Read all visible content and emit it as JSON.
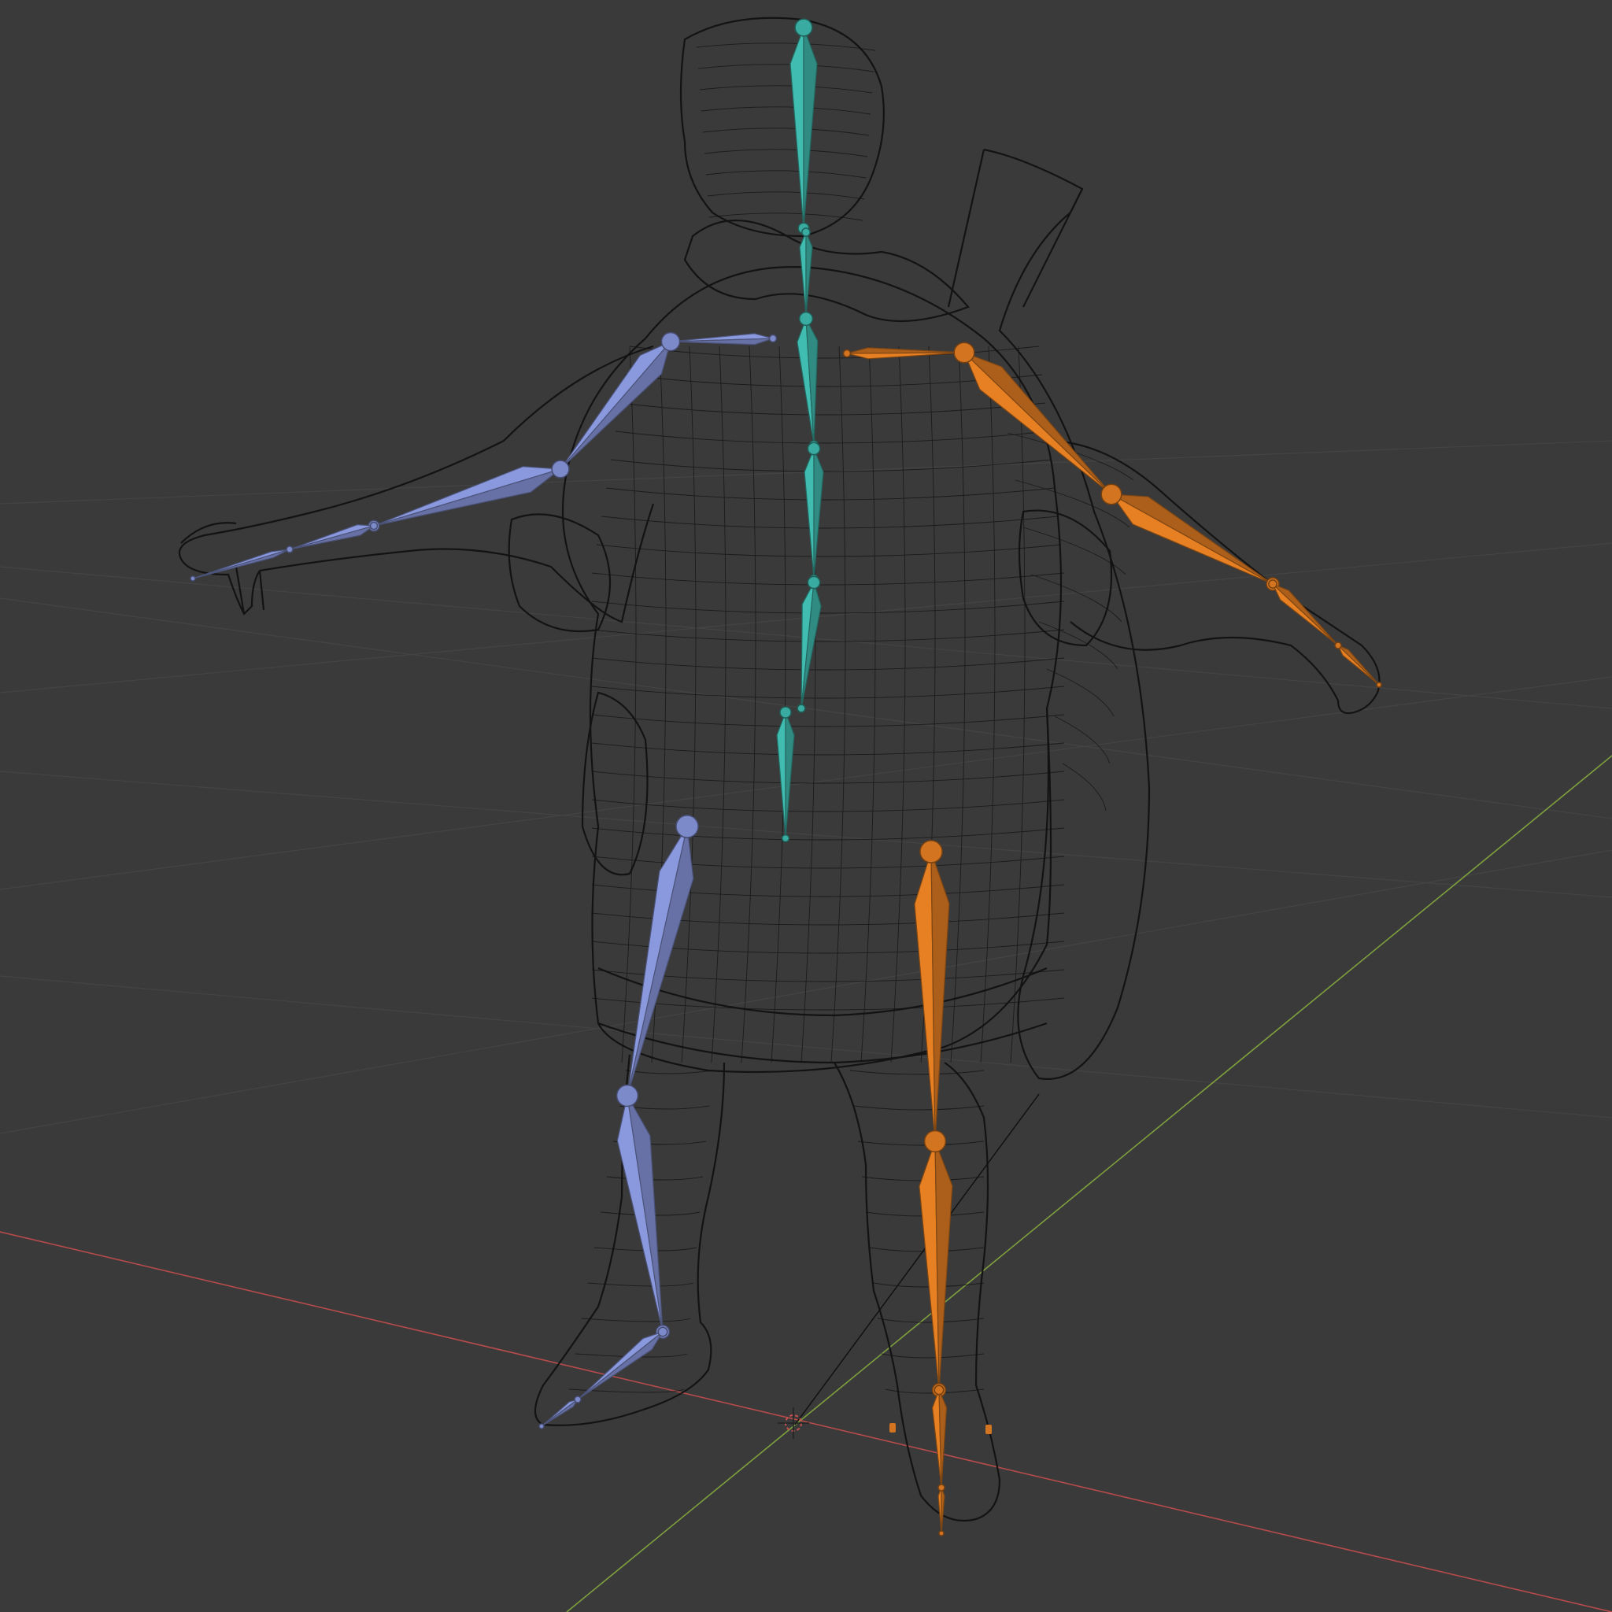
{
  "viewport": {
    "background": "#3a3a3a",
    "grid_color": "#444444",
    "axis_x_color": "#b74b4b",
    "axis_y_color": "#7ea03d"
  },
  "mesh": {
    "name": "character-wireframe",
    "wire_color": "#111111"
  },
  "armature": {
    "center_color": "#3aaba0",
    "left_color": "#7d8ac9",
    "right_color": "#d27420",
    "joint_outline": "#2b2b2b"
  },
  "origin_marker": {
    "icon": "3d-cursor-icon",
    "colors": [
      "#ffffff",
      "#c85050"
    ]
  }
}
